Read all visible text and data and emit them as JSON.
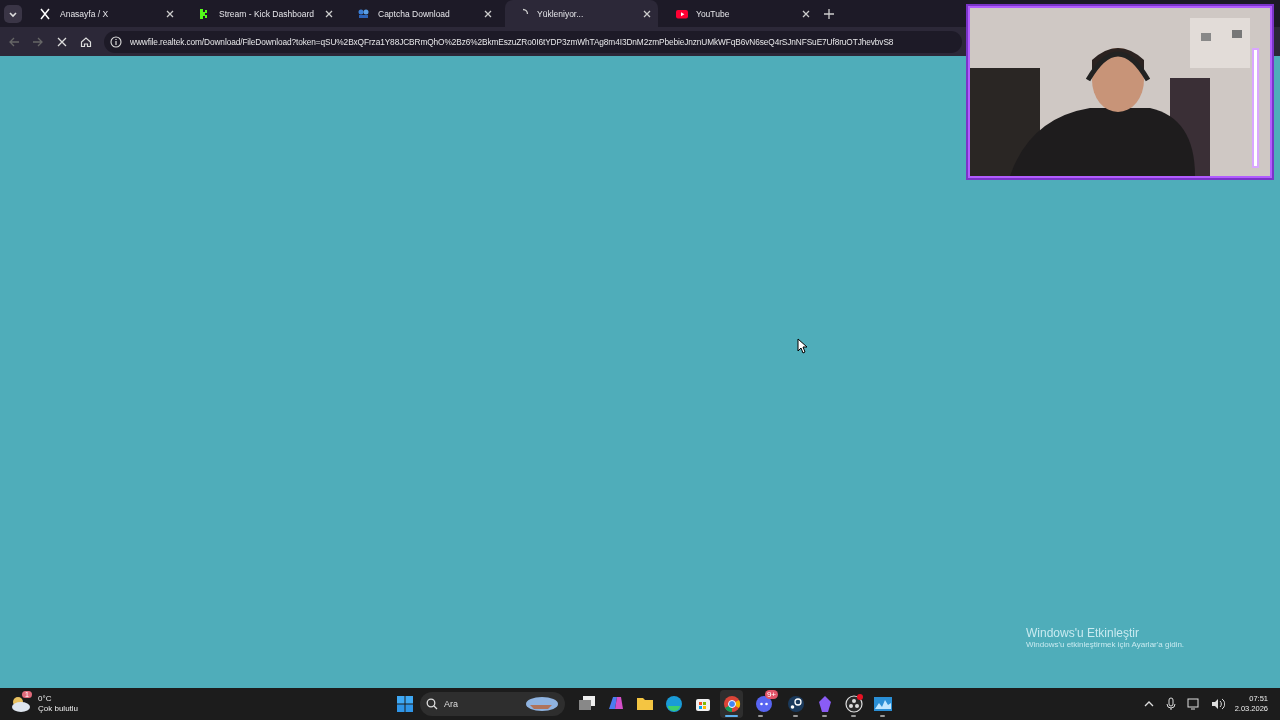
{
  "tabs": [
    {
      "kind": "x",
      "title": "Anasayfa / X",
      "selected": false,
      "loading": false
    },
    {
      "kind": "kick",
      "title": "Stream - Kick Dashboard",
      "selected": false,
      "loading": false
    },
    {
      "kind": "captcha",
      "title": "Captcha Download",
      "selected": false,
      "loading": false
    },
    {
      "title": "Yükleniyor...",
      "selected": true,
      "loading": true
    },
    {
      "kind": "youtube",
      "title": "YouTube",
      "selected": false,
      "loading": false
    }
  ],
  "address_bar": {
    "url": "wwwfile.realtek.com/Download/FileDownload?token=qSU%2BxQFrza1Y88JCBRmQhO%2Bz6%2BkmEszuZRo0I6tYDP3zmWhTAg8m4I3DnM2zmPbebieJnznUMkWFqB6vN6seQ4rSJnNFSuE7Uf8ruOTJhevbvS8",
    "loading": true
  },
  "activation_notice": {
    "title": "Windows'u Etkinleştir",
    "text": "Windows'u etkinleştirmek için Ayarlar'a gidin."
  },
  "taskbar": {
    "weather": {
      "badge": "1",
      "temperature": "0°C",
      "condition": "Çok bulutlu"
    },
    "search": {
      "placeholder": "Ara"
    },
    "apps": [
      {
        "kind": "taskview",
        "running": false,
        "selected": false
      },
      {
        "kind": "m365",
        "running": false,
        "selected": false
      },
      {
        "kind": "folder",
        "running": false,
        "selected": false
      },
      {
        "kind": "edge",
        "running": false,
        "selected": false
      },
      {
        "kind": "store",
        "running": false,
        "selected": false
      },
      {
        "kind": "chrome",
        "running": true,
        "selected": true
      },
      {
        "kind": "discord",
        "running": true,
        "selected": false,
        "badge": "9+"
      },
      {
        "kind": "steam",
        "running": true,
        "selected": false
      },
      {
        "kind": "obsidian",
        "running": true,
        "selected": false
      },
      {
        "kind": "obs",
        "running": true,
        "selected": false,
        "dot": true
      },
      {
        "kind": "monitor",
        "running": true,
        "selected": false
      }
    ],
    "time": "07:51",
    "date": "2.03.2026"
  }
}
